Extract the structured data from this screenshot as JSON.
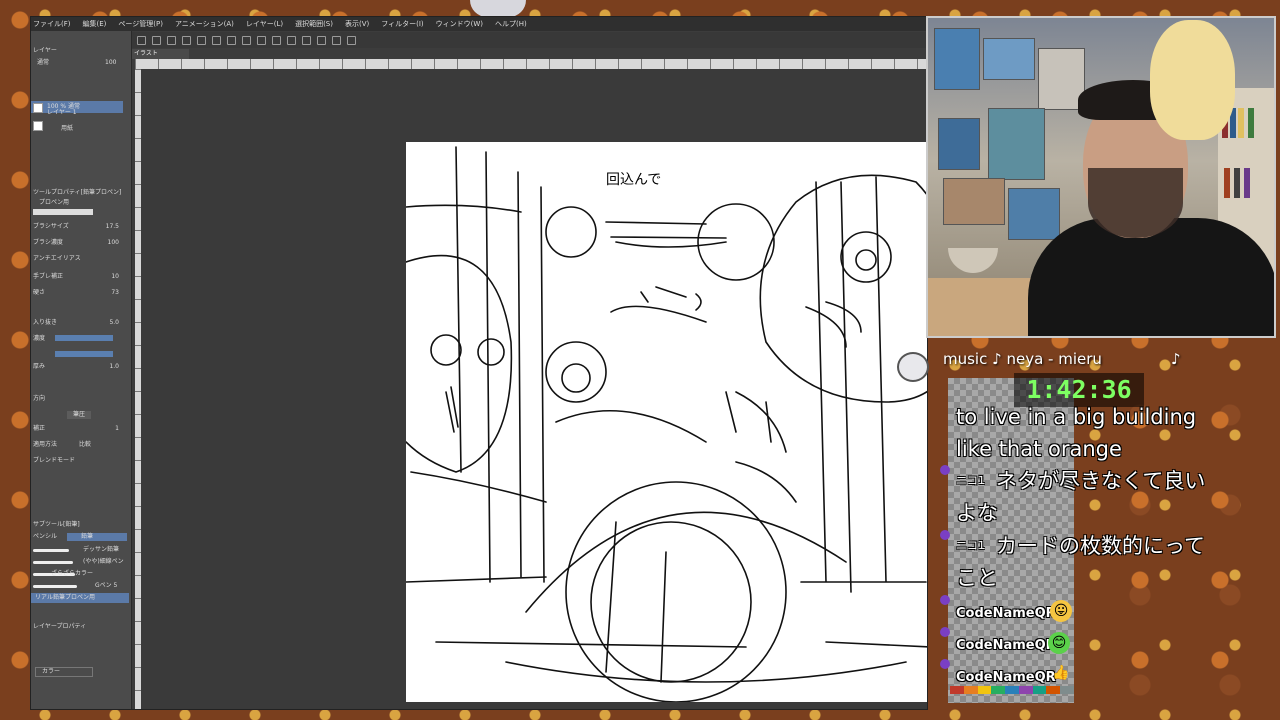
{
  "app": {
    "menu_items": [
      "ファイル(F)",
      "編集(E)",
      "ページ管理(P)",
      "アニメーション(A)",
      "レイヤー(L)",
      "選択範囲(S)",
      "表示(V)",
      "フィルター(I)",
      "ウィンドウ(W)",
      "ヘルプ(H)"
    ],
    "document_tab": "イラスト",
    "canvas_note": "回込んで"
  },
  "left_panel": {
    "layer_section_title": "レイヤー",
    "blend_mode": "通常",
    "opacity": "100",
    "layers": [
      {
        "name": "100 % 通常",
        "sub": "レイヤー 1",
        "selected": true
      },
      {
        "name": "用紙",
        "selected": false
      }
    ],
    "tool_property_title": "ツールプロパティ[鉛筆プロペン]",
    "brush_name": "プロペン用",
    "brush_size_label": "ブラシサイズ",
    "brush_size": "17.5",
    "density_label": "ブラシ濃度",
    "density": "100",
    "antialias_label": "アンチエイリアス",
    "stabilize_label": "手ブレ補正",
    "stabilize": "10",
    "hardness_label": "硬さ",
    "hardness": "73",
    "size_dynamic_label": "入り抜き",
    "size_dynamic": "5.0",
    "brush_density_label": "濃度",
    "thickness_label": "厚み",
    "thickness": "1.0",
    "curve_label": "方向",
    "correction_label": "補正",
    "correction": "1",
    "method_label": "適用方法",
    "method_value": "比較",
    "blend_label": "ブレンドモード",
    "pen_pressure_button": "筆圧",
    "subtool_title": "サブツール[鉛筆]",
    "subtool_tabs": [
      "ペンシル",
      "鉛筆"
    ],
    "brushes": [
      "デッサン鉛筆",
      "(やや)細線ペン",
      "ざらざらカラー",
      "Gペン 5",
      "リアル鉛筆プロペン用"
    ],
    "layer_property_title": "レイヤープロパティ",
    "color_label": "カラー"
  },
  "overlay": {
    "music_label": "music ♪ neya - mieru",
    "music_note": "♪",
    "timer": "1:42:36",
    "chat": [
      {
        "text_lines": [
          "to live in a big building",
          "like that orange"
        ]
      },
      {
        "badge": "ニコ1",
        "text_lines": [
          "ネタが尽きなくて良い",
          "よな"
        ]
      },
      {
        "badge": "ニコ1",
        "text_lines": [
          "カードの枚数的にって",
          "こと"
        ]
      },
      {
        "name": "CodeNameQR",
        "emote": "😛"
      },
      {
        "name": "CodeNameQR",
        "emote": "😊"
      },
      {
        "name": "CodeNameQR",
        "emote": "👍"
      }
    ],
    "strip_colors": [
      "#c0392b",
      "#e67e22",
      "#f1c40f",
      "#27ae60",
      "#2980b9",
      "#8e44ad",
      "#16a085",
      "#d35400",
      "#7f8c8d"
    ]
  }
}
